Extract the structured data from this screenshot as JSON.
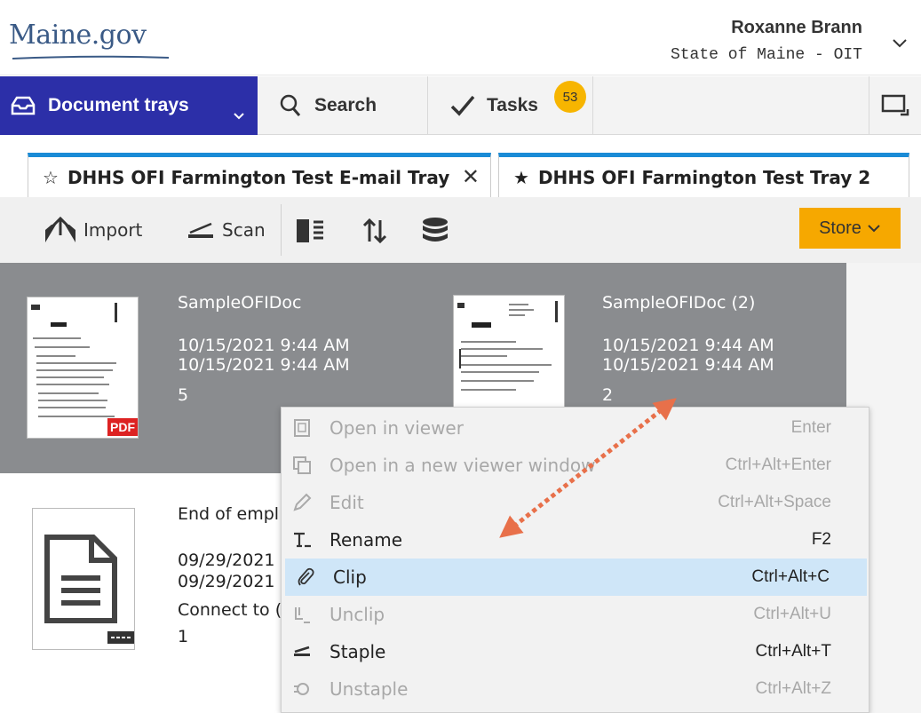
{
  "header": {
    "logo": "Maine.gov",
    "user_name": "Roxanne Brann",
    "user_org": "State of Maine - OIT"
  },
  "nav": {
    "document_trays": "Document trays",
    "search": "Search",
    "tasks": "Tasks",
    "tasks_badge": "53"
  },
  "tabs": [
    {
      "label": "DHHS OFI Farmington Test E-mail Tray",
      "star": "☆",
      "active": true
    },
    {
      "label": "DHHS OFI Farmington Test Tray 2",
      "star": "★",
      "active": false
    }
  ],
  "toolbar": {
    "import": "Import",
    "scan": "Scan",
    "store": "Store"
  },
  "documents": [
    {
      "title": "SampleOFIDoc",
      "date1": "10/15/2021 9:44 AM",
      "date2": "10/15/2021 9:44 AM",
      "pages": "5",
      "tag": "PDF"
    },
    {
      "title": "SampleOFIDoc (2)",
      "date1": "10/15/2021 9:44 AM",
      "date2": "10/15/2021 9:44 AM",
      "pages": "2"
    },
    {
      "title": "End of empl",
      "date1": "09/29/2021",
      "date2": "09/29/2021",
      "line3": "Connect to (",
      "pages": "1"
    }
  ],
  "context_menu": [
    {
      "label": "Open in viewer",
      "shortcut": "Enter",
      "enabled": false
    },
    {
      "label": "Open in a new viewer window",
      "shortcut": "Ctrl+Alt+Enter",
      "enabled": false
    },
    {
      "label": "Edit",
      "shortcut": "Ctrl+Alt+Space",
      "enabled": false
    },
    {
      "label": "Rename",
      "shortcut": "F2",
      "enabled": true
    },
    {
      "label": "Clip",
      "shortcut": "Ctrl+Alt+C",
      "enabled": true,
      "highlighted": true
    },
    {
      "label": "Unclip",
      "shortcut": "Ctrl+Alt+U",
      "enabled": false
    },
    {
      "label": "Staple",
      "shortcut": "Ctrl+Alt+T",
      "enabled": true
    },
    {
      "label": "Unstaple",
      "shortcut": "Ctrl+Alt+Z",
      "enabled": false
    }
  ],
  "colors": {
    "nav_active": "#2c2fa8",
    "tab_accent": "#1a8bd6",
    "store": "#f6a800",
    "badge": "#f7b500",
    "selection": "#8a8c8f",
    "menu_highlight": "#cfe6f8",
    "arrow": "#e8704a"
  }
}
